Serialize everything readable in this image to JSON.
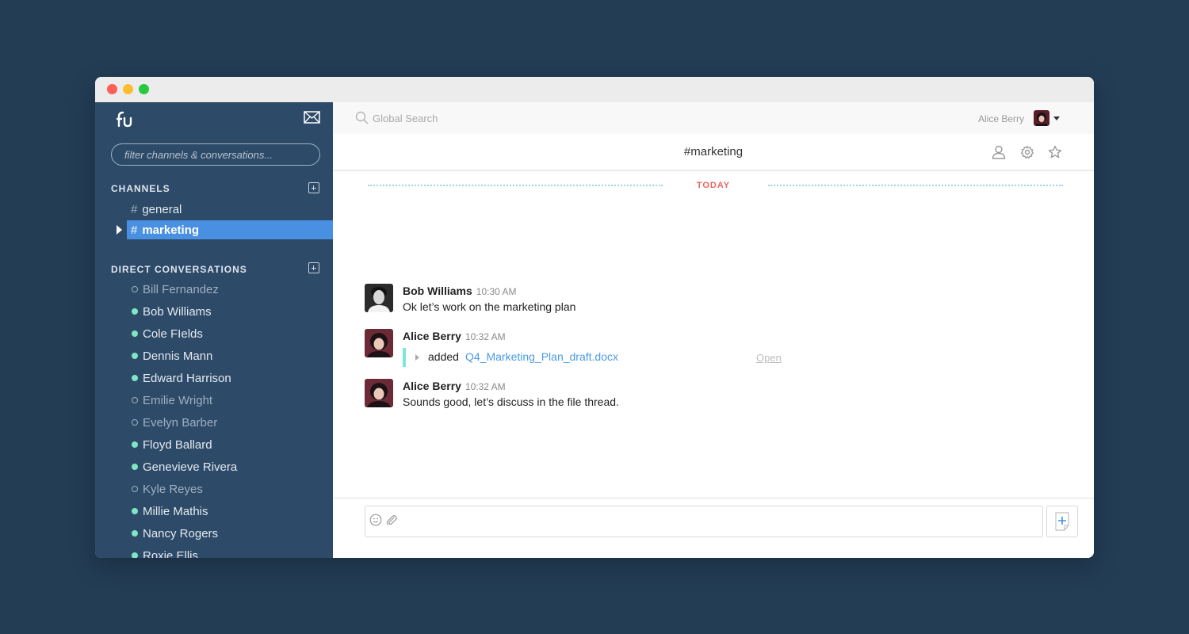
{
  "app": {
    "logo": "fu"
  },
  "sidebar": {
    "filter_placeholder": "filter channels & conversations...",
    "channels_title": "CHANNELS",
    "channels": [
      {
        "name": "general",
        "active": false
      },
      {
        "name": "marketing",
        "active": true
      }
    ],
    "dms_title": "DIRECT CONVERSATIONS",
    "dms": [
      {
        "name": "Bill Fernandez",
        "online": false
      },
      {
        "name": "Bob Williams",
        "online": true
      },
      {
        "name": "Cole FIelds",
        "online": true
      },
      {
        "name": "Dennis Mann",
        "online": true
      },
      {
        "name": "Edward Harrison",
        "online": true
      },
      {
        "name": "Emilie Wright",
        "online": false
      },
      {
        "name": "Evelyn Barber",
        "online": false
      },
      {
        "name": "Floyd Ballard",
        "online": true
      },
      {
        "name": "Genevieve Rivera",
        "online": true
      },
      {
        "name": "Kyle Reyes",
        "online": false
      },
      {
        "name": "Millie Mathis",
        "online": true
      },
      {
        "name": "Nancy Rogers",
        "online": true
      },
      {
        "name": "Roxie Ellis",
        "online": true
      }
    ]
  },
  "topbar": {
    "search_placeholder": "Global Search",
    "user_name": "Alice Berry"
  },
  "channel": {
    "title": "#marketing",
    "hash": "#",
    "day_divider": "TODAY"
  },
  "messages": [
    {
      "author": "Bob Williams",
      "time": "10:30 AM",
      "text": "Ok let’s work on the marketing plan"
    },
    {
      "author": "Alice Berry",
      "time": "10:32 AM",
      "file_action": "added",
      "file_name": "Q4_Marketing_Plan_draft.docx",
      "file_open": "Open"
    },
    {
      "author": "Alice Berry",
      "time": "10:32 AM",
      "text": "Sounds good, let’s discuss in the file thread."
    }
  ],
  "colors": {
    "background": "#233d55",
    "sidebar": "#2d4a68",
    "accent": "#4a90e2",
    "online": "#7ee6c3",
    "today": "#f0625d",
    "link": "#4a9ae8",
    "file_bar": "#7de8d8"
  },
  "icons": {
    "compose": "envelope-icon",
    "search": "search-icon",
    "person": "person-icon",
    "gear": "gear-icon",
    "star": "star-icon",
    "emoji": "smiley-icon",
    "attach": "paperclip-icon",
    "new_doc": "new-document-icon"
  }
}
